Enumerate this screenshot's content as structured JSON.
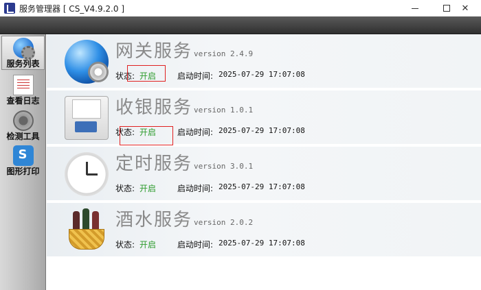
{
  "window": {
    "title": "服务管理器  [ CS_V4.9.2.0 ]",
    "minimize_glyph": "",
    "close_glyph": "✕"
  },
  "sidebar": {
    "items": [
      {
        "label": "服务列表",
        "icon": "globe-gear-icon",
        "active": true
      },
      {
        "label": "查看日志",
        "icon": "log-document-icon",
        "active": false
      },
      {
        "label": "检测工具",
        "icon": "gear-tool-icon",
        "active": false
      },
      {
        "label": "图形打印",
        "icon": "print-app-icon",
        "active": false
      }
    ]
  },
  "services": [
    {
      "name": "网关服务",
      "version": "version 2.4.9",
      "status_label": "状态:",
      "status": "开启",
      "start_label": "启动时间:",
      "start_time": "2025-07-29 17:07:08",
      "icon": "globe-gear-icon"
    },
    {
      "name": "收银服务",
      "version": "version 1.0.1",
      "status_label": "状态:",
      "status": "开启",
      "start_label": "启动时间:",
      "start_time": "2025-07-29 17:07:08",
      "icon": "pos-terminal-icon"
    },
    {
      "name": "定时服务",
      "version": "version 3.0.1",
      "status_label": "状态:",
      "status": "开启",
      "start_label": "启动时间:",
      "start_time": "2025-07-29 17:07:08",
      "icon": "clock-icon"
    },
    {
      "name": "酒水服务",
      "version": "version 2.0.2",
      "status_label": "状态:",
      "status": "开启",
      "start_label": "启动时间:",
      "start_time": "2025-07-29 17:07:08",
      "icon": "wine-basket-icon"
    }
  ],
  "colors": {
    "status_on": "#2e9c2e",
    "highlight_box": "#e02020",
    "service_name": "#8a8a8a"
  }
}
